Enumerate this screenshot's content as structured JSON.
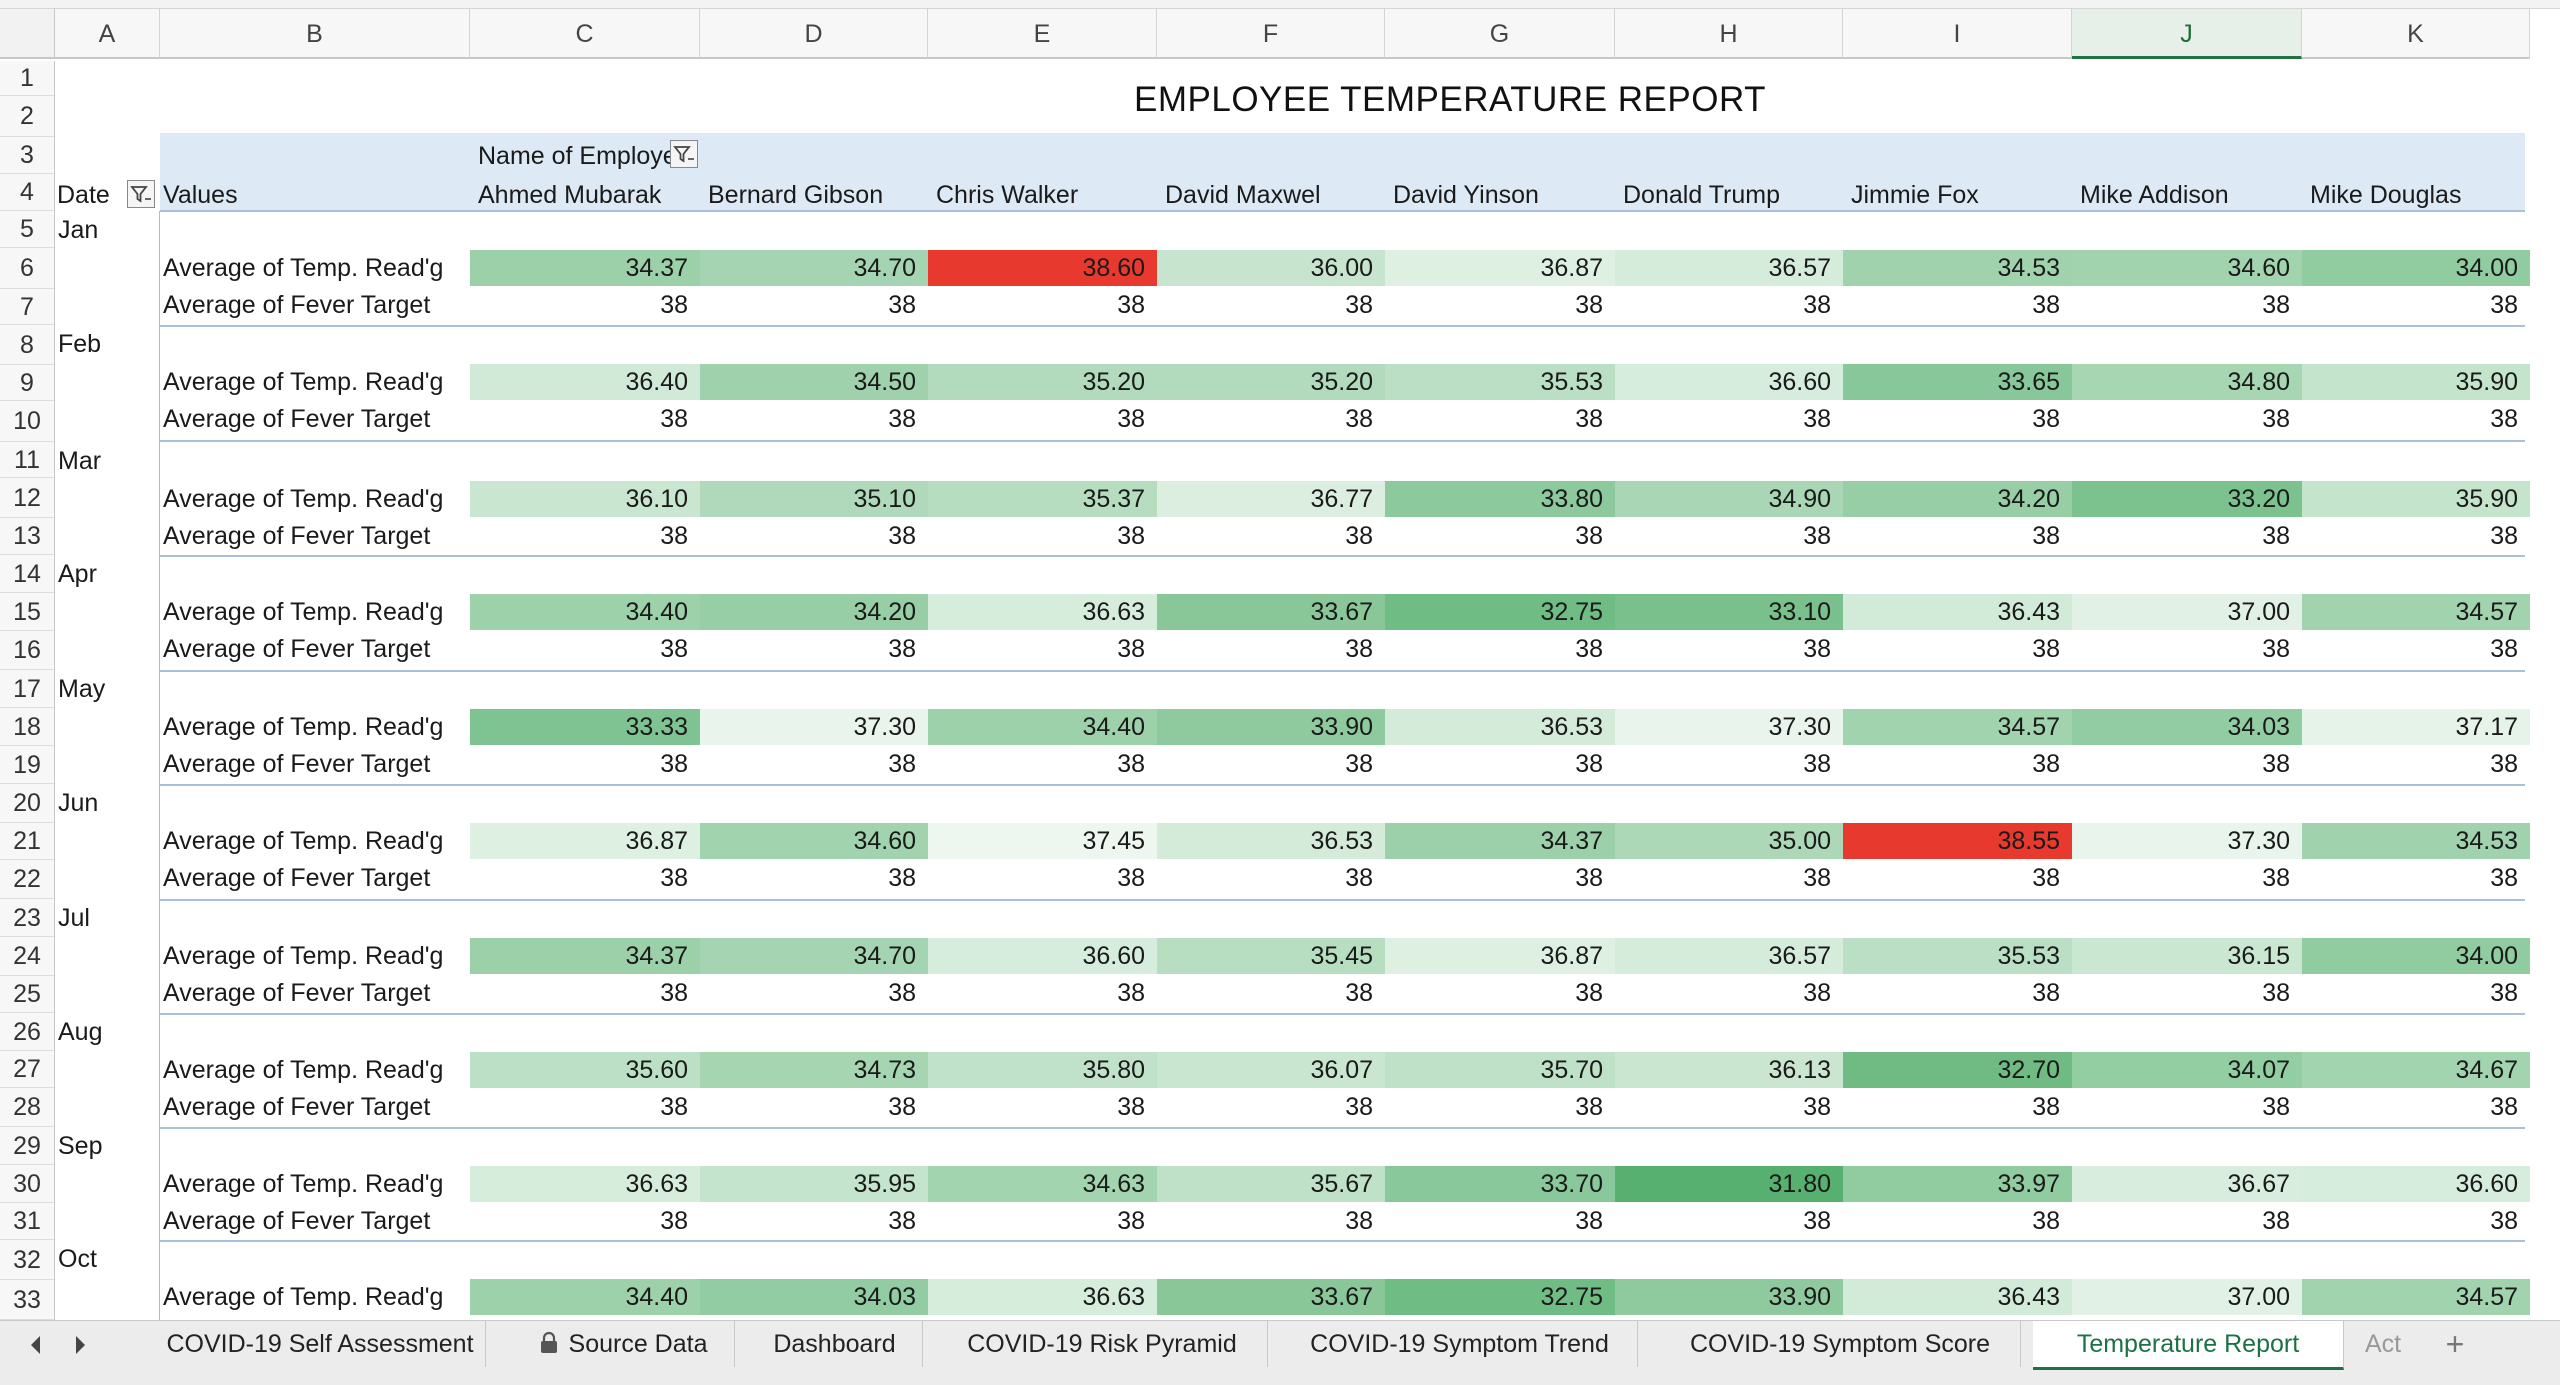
{
  "title": "EMPLOYEE TEMPERATURE REPORT",
  "columns": [
    "A",
    "B",
    "C",
    "D",
    "E",
    "F",
    "G",
    "H",
    "I",
    "J",
    "K"
  ],
  "selected_column": "J",
  "rows": [
    "1",
    "2",
    "3",
    "4",
    "5",
    "6",
    "7",
    "8",
    "9",
    "10",
    "11",
    "12",
    "13",
    "14",
    "15",
    "16",
    "17",
    "18",
    "19",
    "20",
    "21",
    "22",
    "23",
    "24",
    "25",
    "26",
    "27",
    "28",
    "29",
    "30",
    "31",
    "32",
    "33"
  ],
  "pivot": {
    "column_field": "Name of Employee",
    "column_field_visible": "Name of Employe",
    "row_field": "Date",
    "values_label": "Values",
    "employees": [
      "Ahmed Mubarak",
      "Bernard Gibson",
      "Chris Walker",
      "David Maxwel",
      "David Yinson",
      "Donald Trump",
      "Jimmie Fox",
      "Mike Addison",
      "Mike Douglas"
    ],
    "temp_label": "Average of Temp. Read'g",
    "target_label": "Average of Fever Target",
    "months": [
      {
        "name": "Jan",
        "temps": [
          "34.37",
          "34.70",
          "38.60",
          "36.00",
          "36.87",
          "36.57",
          "34.53",
          "34.60",
          "34.00"
        ],
        "target": [
          "38",
          "38",
          "38",
          "38",
          "38",
          "38",
          "38",
          "38",
          "38"
        ]
      },
      {
        "name": "Feb",
        "temps": [
          "36.40",
          "34.50",
          "35.20",
          "35.20",
          "35.53",
          "36.60",
          "33.65",
          "34.80",
          "35.90"
        ],
        "target": [
          "38",
          "38",
          "38",
          "38",
          "38",
          "38",
          "38",
          "38",
          "38"
        ]
      },
      {
        "name": "Mar",
        "temps": [
          "36.10",
          "35.10",
          "35.37",
          "36.77",
          "33.80",
          "34.90",
          "34.20",
          "33.20",
          "35.90"
        ],
        "target": [
          "38",
          "38",
          "38",
          "38",
          "38",
          "38",
          "38",
          "38",
          "38"
        ]
      },
      {
        "name": "Apr",
        "temps": [
          "34.40",
          "34.20",
          "36.63",
          "33.67",
          "32.75",
          "33.10",
          "36.43",
          "37.00",
          "34.57"
        ],
        "target": [
          "38",
          "38",
          "38",
          "38",
          "38",
          "38",
          "38",
          "38",
          "38"
        ]
      },
      {
        "name": "May",
        "temps": [
          "33.33",
          "37.30",
          "34.40",
          "33.90",
          "36.53",
          "37.30",
          "34.57",
          "34.03",
          "37.17"
        ],
        "target": [
          "38",
          "38",
          "38",
          "38",
          "38",
          "38",
          "38",
          "38",
          "38"
        ]
      },
      {
        "name": "Jun",
        "temps": [
          "36.87",
          "34.60",
          "37.45",
          "36.53",
          "34.37",
          "35.00",
          "38.55",
          "37.30",
          "34.53"
        ],
        "target": [
          "38",
          "38",
          "38",
          "38",
          "38",
          "38",
          "38",
          "38",
          "38"
        ]
      },
      {
        "name": "Jul",
        "temps": [
          "34.37",
          "34.70",
          "36.60",
          "35.45",
          "36.87",
          "36.57",
          "35.53",
          "36.15",
          "34.00"
        ],
        "target": [
          "38",
          "38",
          "38",
          "38",
          "38",
          "38",
          "38",
          "38",
          "38"
        ]
      },
      {
        "name": "Aug",
        "temps": [
          "35.60",
          "34.73",
          "35.80",
          "36.07",
          "35.70",
          "36.13",
          "32.70",
          "34.07",
          "34.67"
        ],
        "target": [
          "38",
          "38",
          "38",
          "38",
          "38",
          "38",
          "38",
          "38",
          "38"
        ]
      },
      {
        "name": "Sep",
        "temps": [
          "36.63",
          "35.95",
          "34.63",
          "35.67",
          "33.70",
          "31.80",
          "33.97",
          "36.67",
          "36.60"
        ],
        "target": [
          "38",
          "38",
          "38",
          "38",
          "38",
          "38",
          "38",
          "38",
          "38"
        ]
      },
      {
        "name": "Oct",
        "temps": [
          "34.40",
          "34.03",
          "36.63",
          "33.67",
          "32.75",
          "33.90",
          "36.43",
          "37.00",
          "34.57"
        ],
        "target": []
      }
    ]
  },
  "colors": {
    "fever": "#e8392e",
    "cool_dark": "#57b06f",
    "cool_light": "#edf7ef"
  },
  "sheet_tabs": [
    "COVID-19 Self Assessment",
    "Source Data",
    "Dashboard",
    "COVID-19 Risk Pyramid",
    "COVID-19 Symptom Trend",
    "COVID-19 Symptom Score",
    "Temperature Report",
    "Act"
  ],
  "active_tab": "Temperature Report",
  "add_sheet_label": "+"
}
